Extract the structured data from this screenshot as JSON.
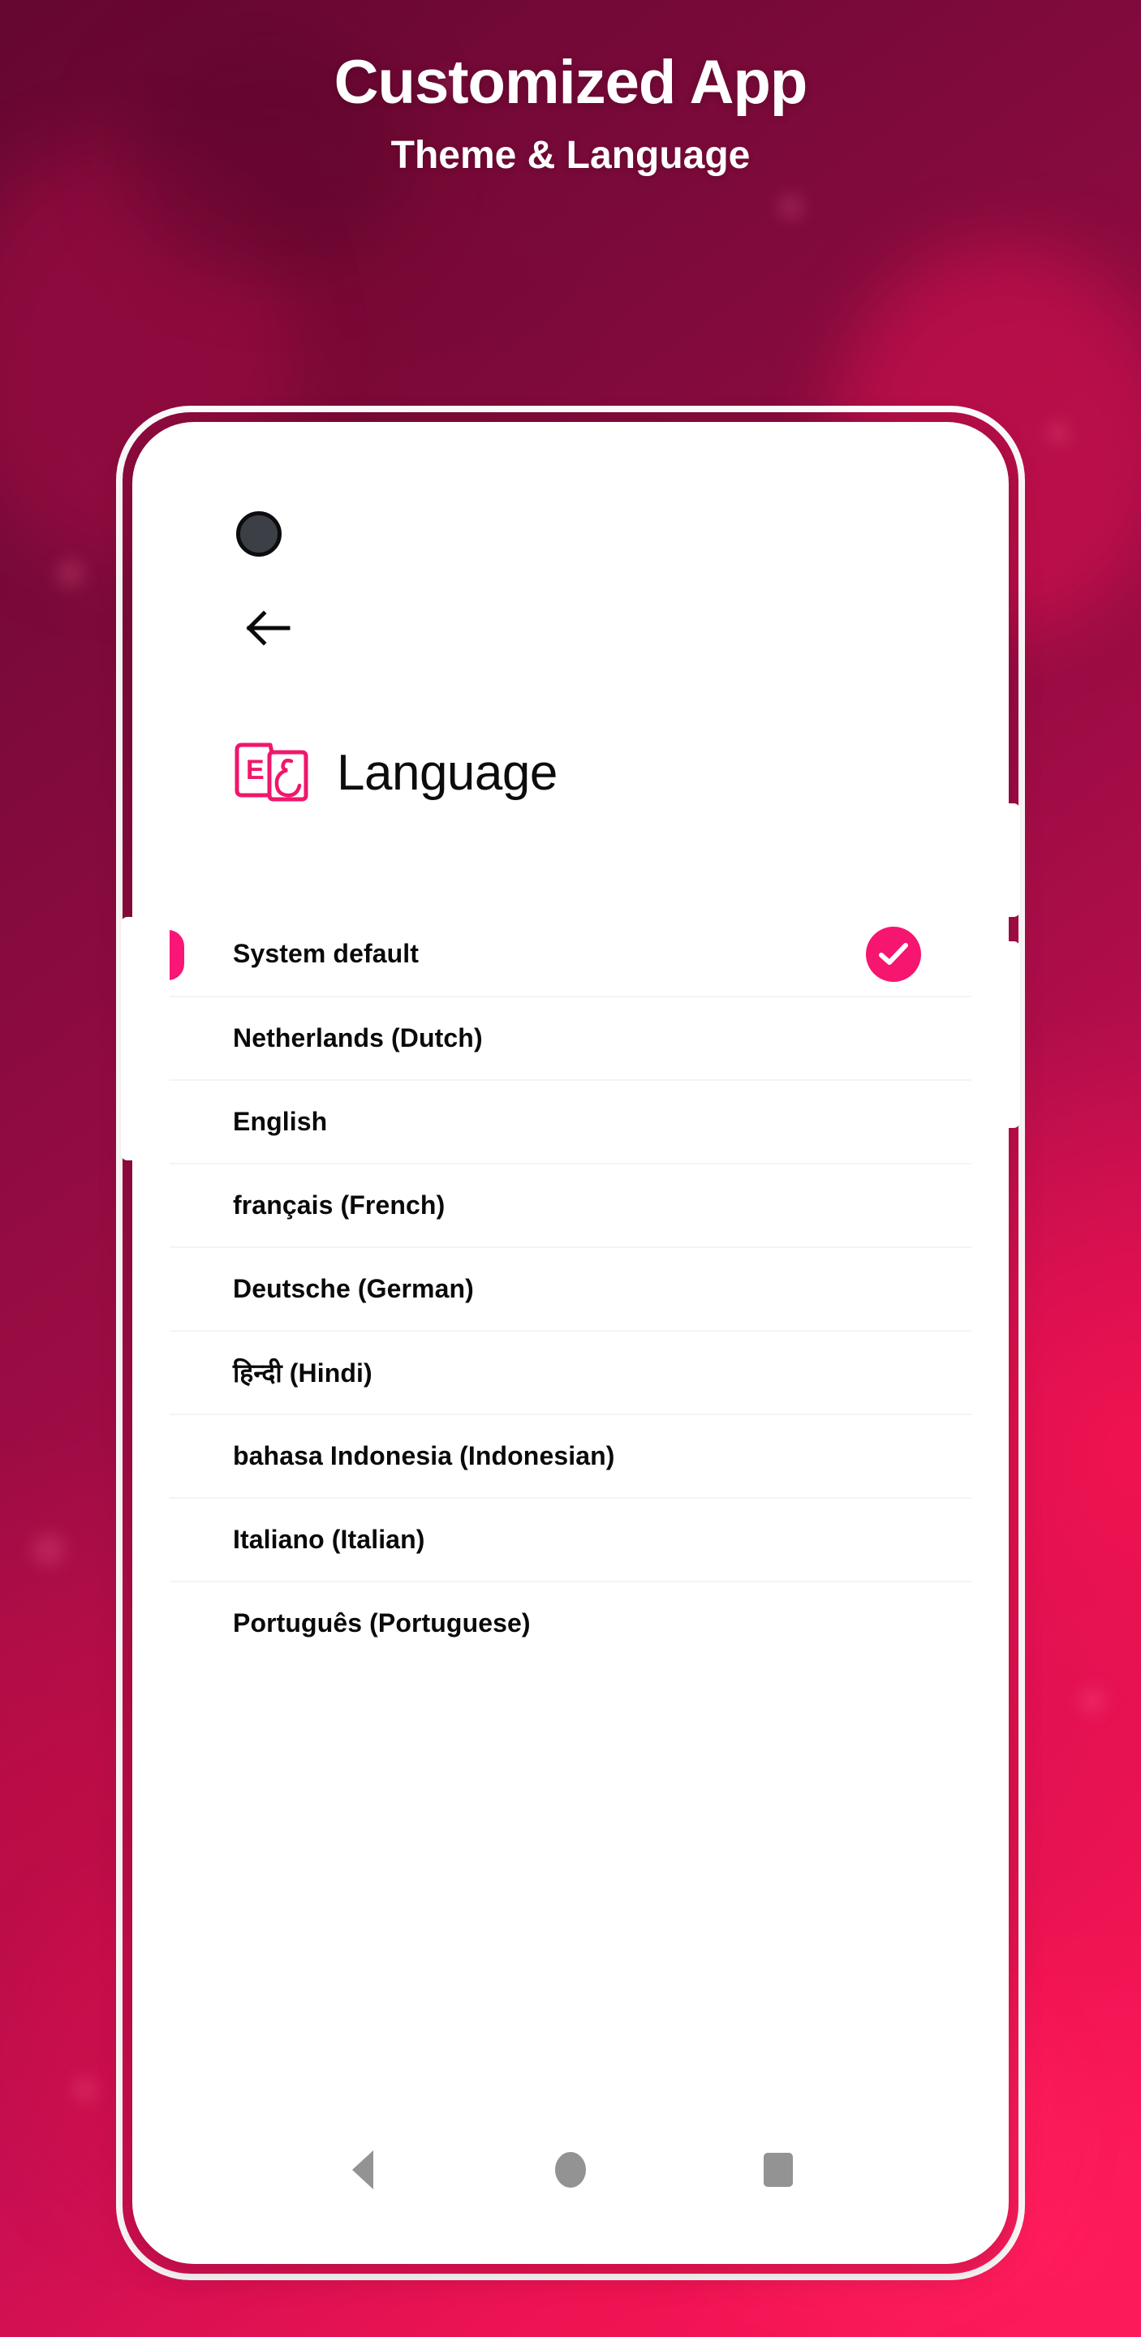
{
  "promo": {
    "title": "Customized App",
    "subtitle": "Theme & Language"
  },
  "colors": {
    "accent_pink": "#F6156F",
    "indicator_pink": "#FA1577",
    "logo_pink": "#F0176B",
    "bg_dark": "#650730",
    "bg_bright": "#F8165A",
    "nav_gray": "#939393",
    "separator": "#F4F4F4"
  },
  "phone": {
    "camera": "front-camera-punch-hole",
    "buttons": {
      "volume": "volume-rocker",
      "power": "power-button"
    }
  },
  "screen": {
    "back_button": "back-arrow-icon",
    "app_logo": "language-cards-logo",
    "page_title": "Language",
    "languages": [
      {
        "label": "System default",
        "selected": true
      },
      {
        "label": "Netherlands (Dutch)",
        "selected": false
      },
      {
        "label": "English",
        "selected": false
      },
      {
        "label": "français (French)",
        "selected": false
      },
      {
        "label": "Deutsche (German)",
        "selected": false
      },
      {
        "label": "हिन्दी (Hindi)",
        "selected": false
      },
      {
        "label": "bahasa Indonesia (Indonesian)",
        "selected": false
      },
      {
        "label": "Italiano (Italian)",
        "selected": false
      },
      {
        "label": "Português (Portuguese)",
        "selected": false
      }
    ],
    "selected_check": "check-icon",
    "navbar": {
      "back": "nav-back-triangle-icon",
      "home": "nav-home-circle-icon",
      "recents": "nav-recents-square-icon"
    }
  }
}
